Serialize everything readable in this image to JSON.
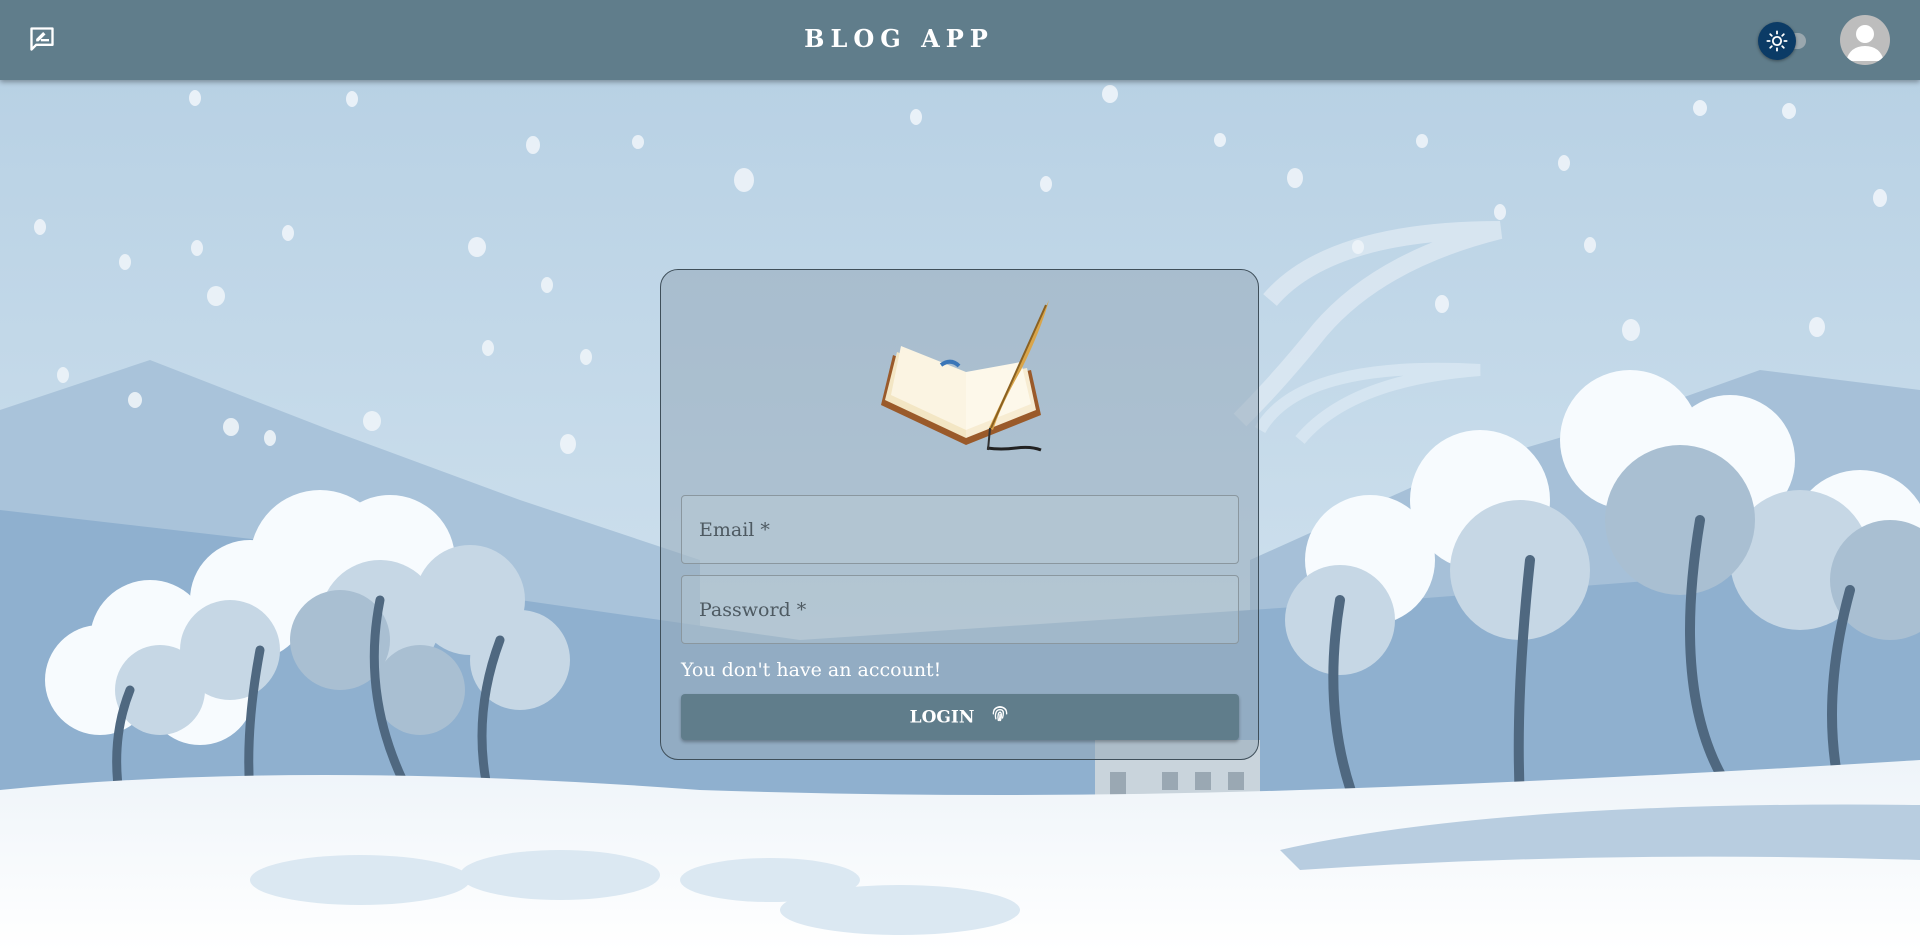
{
  "header": {
    "title": "BLOG APP",
    "blog_icon": "rate-review-icon",
    "theme_icon": "sun-icon",
    "avatar_icon": "user-avatar-icon"
  },
  "login": {
    "logo_icon": "book-quill-icon",
    "email_placeholder": "Email *",
    "password_placeholder": "Password *",
    "signup_link": "You don't have an account!",
    "button_label": "LOGIN",
    "button_icon": "fingerprint-icon"
  },
  "colors": {
    "appbar": "#607d8b",
    "toggle_thumb": "#0b3b66",
    "button": "#607d8b"
  }
}
